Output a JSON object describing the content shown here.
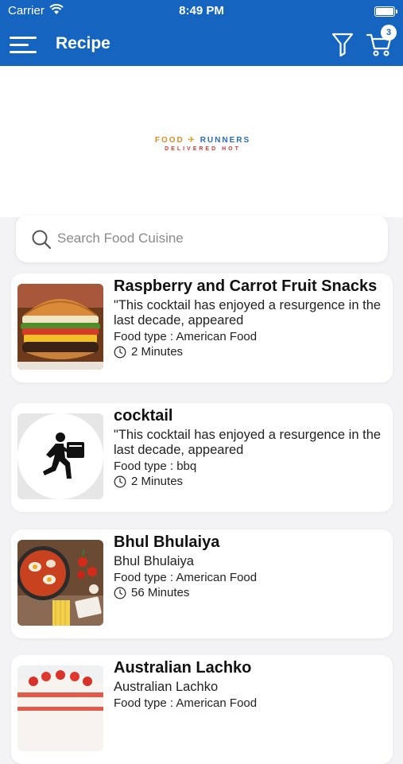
{
  "status": {
    "carrier": "Carrier",
    "time": "8:49 PM"
  },
  "appbar": {
    "title": "Recipe",
    "cart_count": "3"
  },
  "banner": {
    "brand_food": "FOOD",
    "brand_runners": "RUNNERS",
    "tagline": "DELIVERED HOT"
  },
  "search": {
    "placeholder": "Search Food Cuisine",
    "value": ""
  },
  "recipes": [
    {
      "title": "Raspberry and Carrot Fruit Snacks",
      "description": "\"This cocktail has enjoyed a resurgence in the last decade, appeared",
      "food_type": "Food type : American Food",
      "duration": "2 Minutes",
      "image": "burger"
    },
    {
      "title": "cocktail",
      "description": "\"This cocktail has enjoyed a resurgence in the last decade, appeared",
      "food_type": "Food type : bbq",
      "duration": "2 Minutes",
      "image": "delivery-person-icon"
    },
    {
      "title": "Bhul Bhulaiya",
      "description": "Bhul Bhulaiya",
      "food_type": "Food type : American Food",
      "duration": "56 Minutes",
      "image": "shakshuka-pan"
    },
    {
      "title": "Australian Lachko",
      "description": "Australian Lachko",
      "food_type": "Food type : American Food",
      "duration": "",
      "image": "strawberry-cake"
    }
  ],
  "colors": {
    "primary": "#1565c0",
    "background": "#f3f3f5"
  }
}
